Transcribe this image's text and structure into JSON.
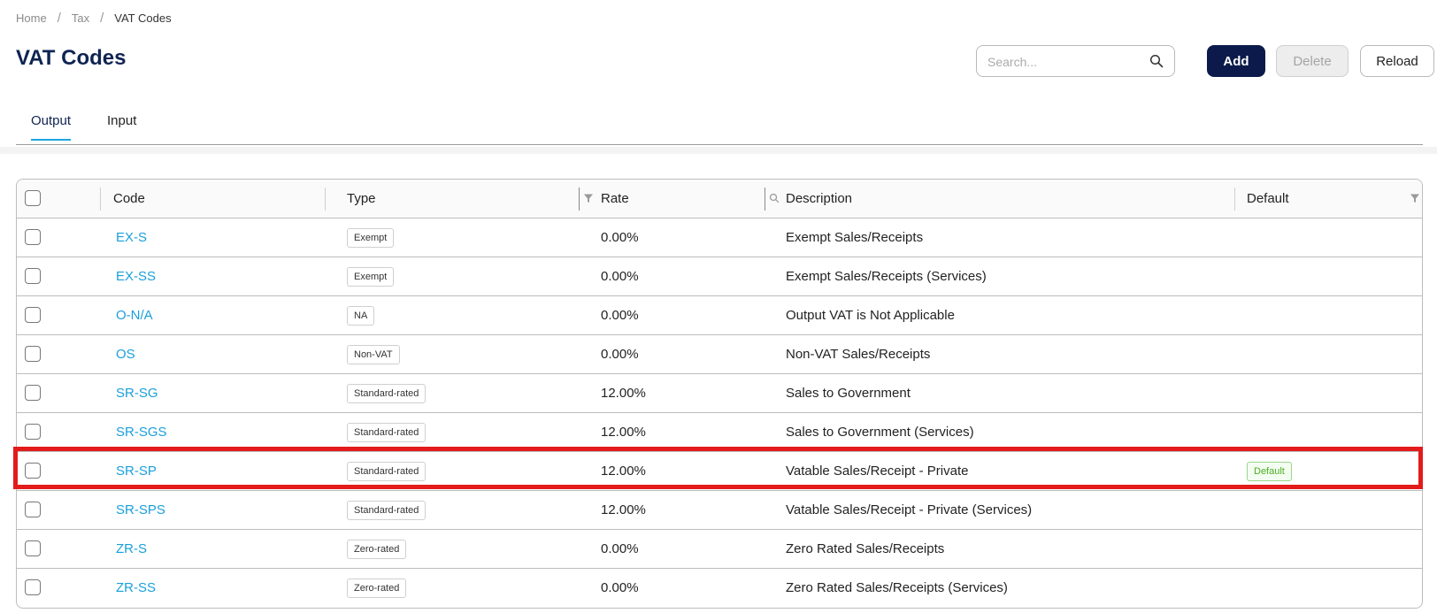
{
  "breadcrumb": {
    "items": [
      "Home",
      "Tax",
      "VAT Codes"
    ],
    "separator": "/"
  },
  "page": {
    "title": "VAT Codes"
  },
  "search": {
    "placeholder": "Search...",
    "value": "",
    "icon": "search-icon"
  },
  "toolbar": {
    "add_label": "Add",
    "delete_label": "Delete",
    "reload_label": "Reload",
    "delete_disabled": true
  },
  "tabs": [
    {
      "label": "Output",
      "active": true
    },
    {
      "label": "Input",
      "active": false
    }
  ],
  "table": {
    "columns": {
      "code": "Code",
      "type": "Type",
      "rate": "Rate",
      "description": "Description",
      "default": "Default"
    },
    "rows": [
      {
        "code": "EX-S",
        "type": "Exempt",
        "rate": "0.00%",
        "description": "Exempt Sales/Receipts",
        "default": ""
      },
      {
        "code": "EX-SS",
        "type": "Exempt",
        "rate": "0.00%",
        "description": "Exempt Sales/Receipts (Services)",
        "default": ""
      },
      {
        "code": "O-N/A",
        "type": "NA",
        "rate": "0.00%",
        "description": "Output VAT is Not Applicable",
        "default": ""
      },
      {
        "code": "OS",
        "type": "Non-VAT",
        "rate": "0.00%",
        "description": "Non-VAT Sales/Receipts",
        "default": ""
      },
      {
        "code": "SR-SG",
        "type": "Standard-rated",
        "rate": "12.00%",
        "description": "Sales to Government",
        "default": ""
      },
      {
        "code": "SR-SGS",
        "type": "Standard-rated",
        "rate": "12.00%",
        "description": "Sales to Government (Services)",
        "default": ""
      },
      {
        "code": "SR-SP",
        "type": "Standard-rated",
        "rate": "12.00%",
        "description": "Vatable Sales/Receipt - Private",
        "default": "Default"
      },
      {
        "code": "SR-SPS",
        "type": "Standard-rated",
        "rate": "12.00%",
        "description": "Vatable Sales/Receipt - Private (Services)",
        "default": ""
      },
      {
        "code": "ZR-S",
        "type": "Zero-rated",
        "rate": "0.00%",
        "description": "Zero Rated Sales/Receipts",
        "default": ""
      },
      {
        "code": "ZR-SS",
        "type": "Zero-rated",
        "rate": "0.00%",
        "description": "Zero Rated Sales/Receipts (Services)",
        "default": ""
      }
    ]
  },
  "colors": {
    "title": "#0f2452",
    "link": "#1a9fda",
    "primary_button": "#0b1a4a",
    "active_tab_underline": "#1aa6e0",
    "default_badge": "#4caf22",
    "highlight": "#e31b1b"
  }
}
